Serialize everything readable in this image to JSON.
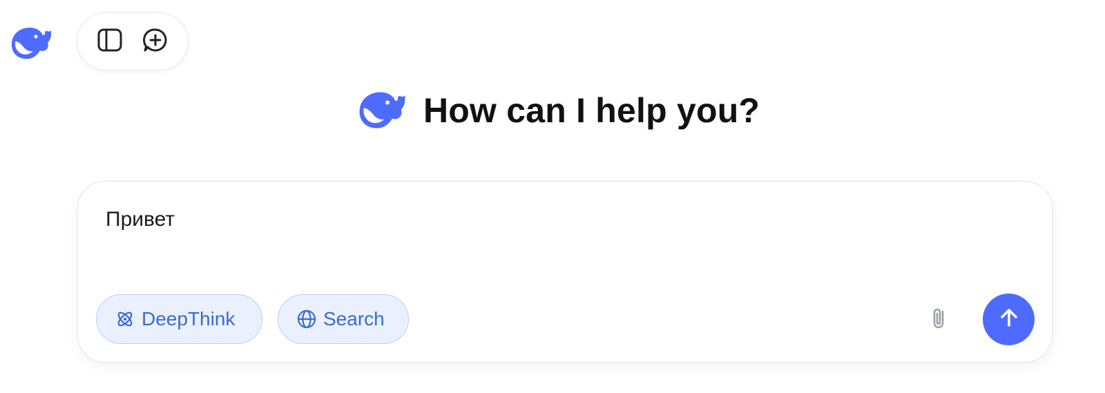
{
  "colors": {
    "brand": "#4d6bfe",
    "chip_bg": "#eaf0fe",
    "chip_border": "#b9cdf3",
    "chip_text": "#3a6ad8",
    "title_text": "#111111",
    "icon_gray": "#9aa0a6"
  },
  "header": {
    "logo_icon": "whale-logo-icon",
    "actions": [
      {
        "icon": "sidebar-toggle-icon"
      },
      {
        "icon": "new-chat-icon"
      }
    ]
  },
  "hero": {
    "logo_icon": "whale-logo-icon",
    "title": "How can I help you?"
  },
  "composer": {
    "input_value": "Привет",
    "chips": [
      {
        "icon": "atom-icon",
        "label": "DeepThink"
      },
      {
        "icon": "globe-icon",
        "label": "Search"
      }
    ],
    "attach_icon": "paperclip-icon",
    "send_icon": "arrow-up-icon"
  }
}
